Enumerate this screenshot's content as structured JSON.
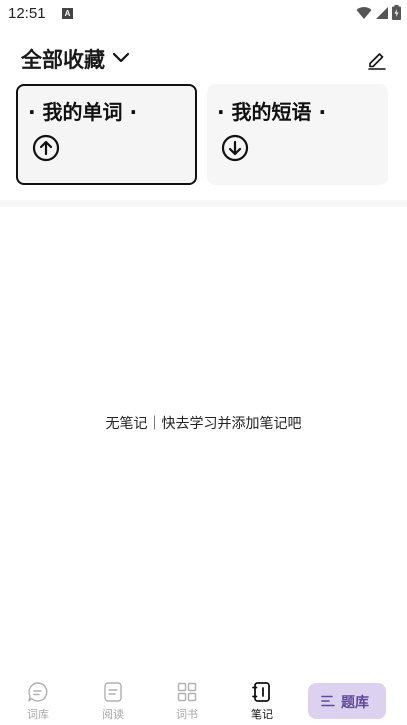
{
  "status_bar": {
    "time": "12:51",
    "notification_icon": "a-icon",
    "icons": [
      "wifi-icon",
      "signal-icon",
      "battery-icon"
    ]
  },
  "header": {
    "title": "全部收藏",
    "dropdown_icon": "chevron-down-icon",
    "edit_icon": "edit-icon"
  },
  "cards": [
    {
      "label": "· 我的单词 ·",
      "icon": "arrow-up-circle-icon",
      "selected": true
    },
    {
      "label": "· 我的短语 ·",
      "icon": "arrow-down-circle-icon",
      "selected": false
    }
  ],
  "empty_state": {
    "text": "无笔记｜快去学习并添加笔记吧"
  },
  "tabbar": {
    "tabs": [
      {
        "label": "词库",
        "icon": "chat-icon",
        "active": false
      },
      {
        "label": "阅读",
        "icon": "document-icon",
        "active": false
      },
      {
        "label": "词书",
        "icon": "grid-icon",
        "active": false
      },
      {
        "label": "笔记",
        "icon": "notebook-icon",
        "active": true
      }
    ],
    "quiz_button": {
      "label": "题库",
      "icon": "list-icon"
    }
  },
  "colors": {
    "accent_bg": "#dcd2f0",
    "accent_text": "#5f4a99",
    "inactive_tab": "#a8a8a8",
    "card_bg": "#f5f5f5"
  }
}
